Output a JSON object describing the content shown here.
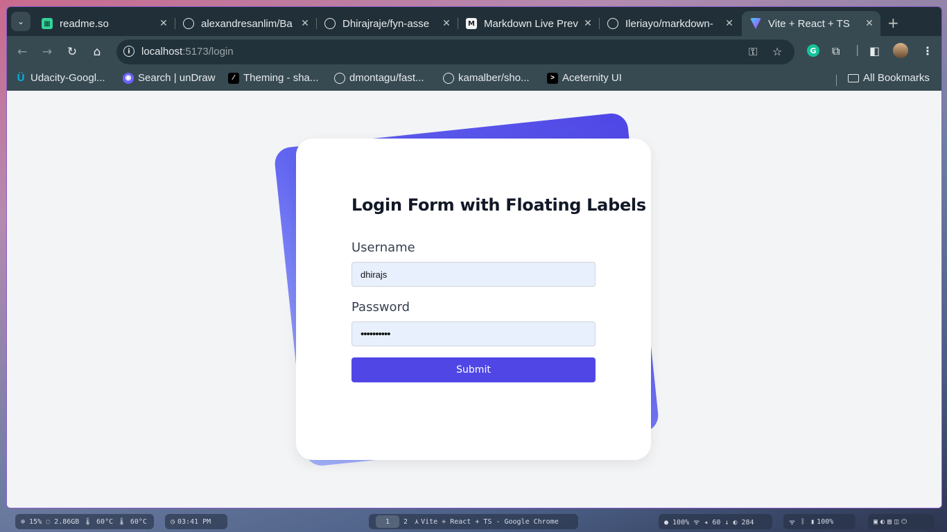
{
  "browser": {
    "tabs": [
      {
        "title": "readme.so",
        "favicon": "readme-icon",
        "active": false
      },
      {
        "title": "alexandresanlim/Ba",
        "favicon": "github-icon",
        "active": false
      },
      {
        "title": "Dhirajraje/fyn-asse",
        "favicon": "github-icon",
        "active": false
      },
      {
        "title": "Markdown Live Prev",
        "favicon": "markdown-icon",
        "active": false
      },
      {
        "title": "Ileriayo/markdown-",
        "favicon": "github-icon",
        "active": false
      },
      {
        "title": "Vite + React + TS",
        "favicon": "vite-icon",
        "active": true
      }
    ],
    "url_host": "localhost",
    "url_path": ":5173/login",
    "bookmarks": [
      {
        "label": "Udacity-Googl...",
        "icon": "udacity-icon"
      },
      {
        "label": "Search | unDraw",
        "icon": "undraw-icon"
      },
      {
        "label": "Theming - sha...",
        "icon": "shadcn-icon"
      },
      {
        "label": "dmontagu/fast...",
        "icon": "github-icon"
      },
      {
        "label": "kamalber/sho...",
        "icon": "github-icon"
      },
      {
        "label": "Aceternity UI",
        "icon": "aceternity-icon"
      }
    ],
    "all_bookmarks": "All Bookmarks"
  },
  "login": {
    "title": "Login Form with Floating Labels",
    "username_label": "Username",
    "username_value": "dhirajs",
    "password_label": "Password",
    "password_value": "••••••••••",
    "submit_label": "Submit"
  },
  "taskbar": {
    "stats": "⊚ 15% ◌ 2.86GB 🌡 60°C 🌡 60°C",
    "clock": "03:41 PM",
    "ws1": "1",
    "ws2": "2",
    "window_title": "Vite + React + TS - Google Chrome",
    "system": "● 100% ᯤ ◂ 60 ↓ ◐ 284",
    "tray": "100%"
  },
  "colors": {
    "accent": "#4f46e5",
    "tab_strip": "#213038",
    "toolbar": "#374a52"
  }
}
